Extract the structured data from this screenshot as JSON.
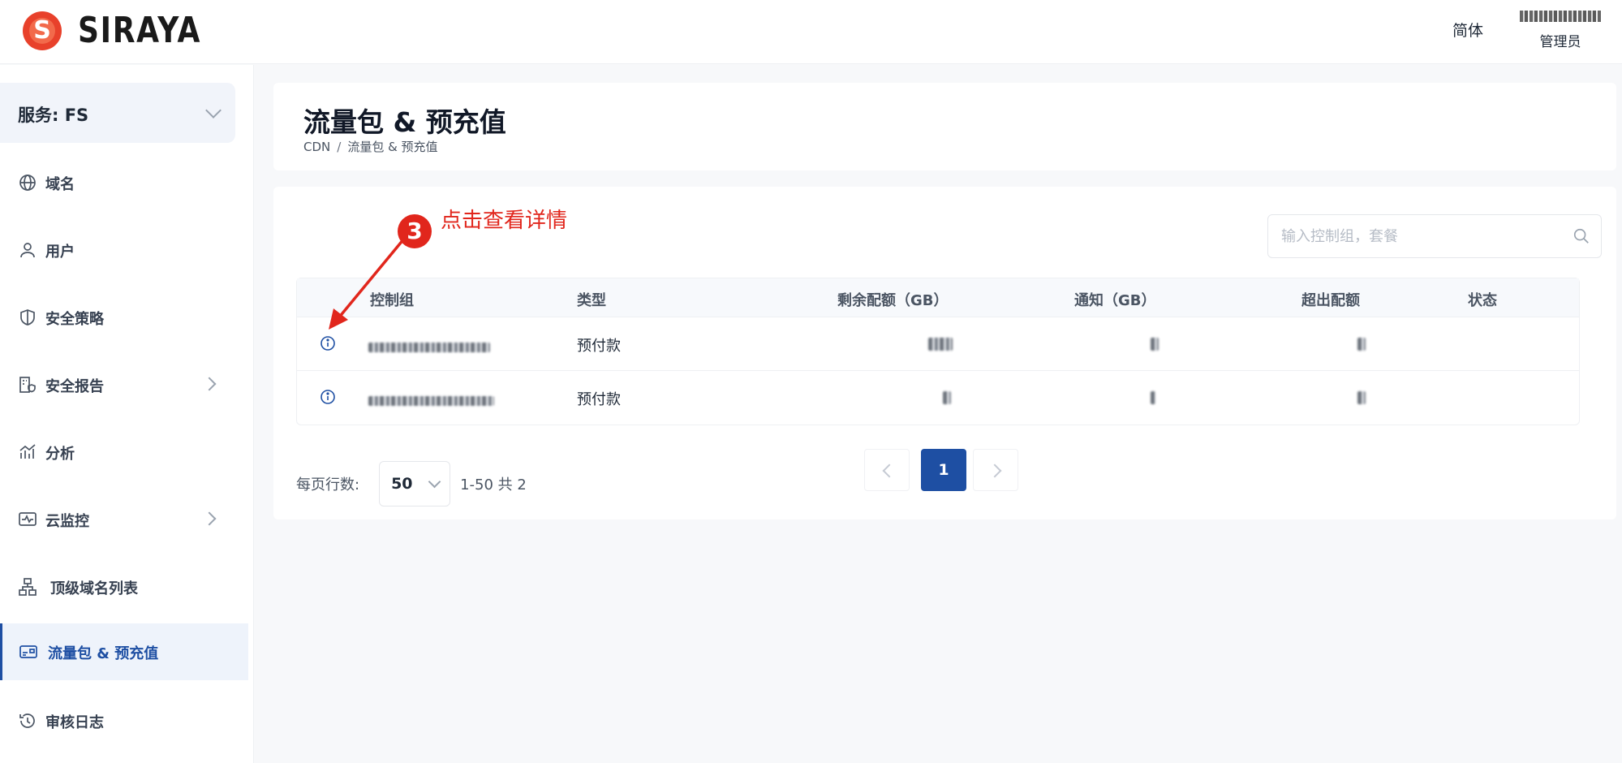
{
  "header": {
    "brand": "SIRAYA",
    "brand_initial": "S",
    "language": "简体",
    "user_role": "管理员"
  },
  "sidebar": {
    "service_label": "服务: FS",
    "items": [
      {
        "label": "域名",
        "icon": "globe-icon"
      },
      {
        "label": "用户",
        "icon": "user-icon"
      },
      {
        "label": "安全策略",
        "icon": "shield-icon"
      },
      {
        "label": "安全报告",
        "icon": "building-shield-icon"
      },
      {
        "label": "分析",
        "icon": "chart-line-icon"
      },
      {
        "label": "云监控",
        "icon": "monitor-pulse-icon"
      },
      {
        "label": "顶级域名列表",
        "icon": "sitemap-icon"
      },
      {
        "label": "流量包 & 预充值",
        "icon": "card-icon"
      },
      {
        "label": "审核日志",
        "icon": "history-icon"
      }
    ]
  },
  "page": {
    "title": "流量包 & 预充值",
    "breadcrumb": [
      "CDN",
      "流量包 & 预充值"
    ]
  },
  "search": {
    "placeholder": "输入控制组，套餐"
  },
  "table": {
    "columns": [
      "控制组",
      "类型",
      "剩余配额（GB）",
      "通知（GB）",
      "超出配额",
      "状态"
    ],
    "rows": [
      {
        "type": "预付款"
      },
      {
        "type": "预付款"
      }
    ]
  },
  "pagination": {
    "rows_per_page_label": "每页行数:",
    "rows_per_page": "50",
    "range": "1-50 共 2",
    "current_page": "1"
  },
  "annotation": {
    "step": "3",
    "text": "点击查看详情",
    "color": "#e1261c"
  },
  "colors": {
    "accent": "#1e4fa3",
    "brand": "#e8412b"
  }
}
